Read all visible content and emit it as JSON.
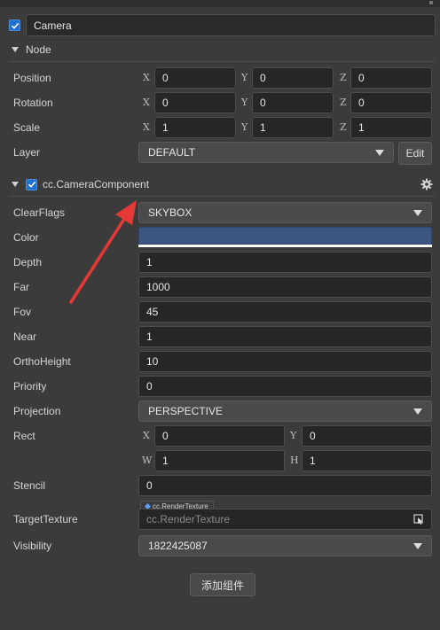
{
  "node_name": "Camera",
  "node_section": {
    "title": "Node"
  },
  "node_props": {
    "position": {
      "label": "Position",
      "x": "0",
      "y": "0",
      "z": "0"
    },
    "rotation": {
      "label": "Rotation",
      "x": "0",
      "y": "0",
      "z": "0"
    },
    "scale": {
      "label": "Scale",
      "x": "1",
      "y": "1",
      "z": "1"
    },
    "layer": {
      "label": "Layer",
      "value": "DEFAULT",
      "edit_label": "Edit"
    }
  },
  "axes": {
    "x": "X",
    "y": "Y",
    "z": "Z",
    "w": "W",
    "h": "H"
  },
  "component": {
    "title": "cc.CameraComponent",
    "clear_flags": {
      "label": "ClearFlags",
      "value": "SKYBOX"
    },
    "color": {
      "label": "Color",
      "swatch": "#3b5683"
    },
    "depth": {
      "label": "Depth",
      "value": "1"
    },
    "far": {
      "label": "Far",
      "value": "1000"
    },
    "fov": {
      "label": "Fov",
      "value": "45"
    },
    "near": {
      "label": "Near",
      "value": "1"
    },
    "ortho_height": {
      "label": "OrthoHeight",
      "value": "10"
    },
    "priority": {
      "label": "Priority",
      "value": "0"
    },
    "projection": {
      "label": "Projection",
      "value": "PERSPECTIVE"
    },
    "rect": {
      "label": "Rect",
      "x": "0",
      "y": "0",
      "w": "1",
      "h": "1"
    },
    "stencil": {
      "label": "Stencil",
      "value": "0"
    },
    "target_texture": {
      "label": "TargetTexture",
      "type_tag": "cc.RenderTexture",
      "placeholder": "cc.RenderTexture"
    },
    "visibility": {
      "label": "Visibility",
      "value": "1822425087"
    }
  },
  "add_component_label": "添加组件",
  "colors": {
    "accent": "#1f6fd1",
    "annotation_arrow": "#e53935"
  }
}
